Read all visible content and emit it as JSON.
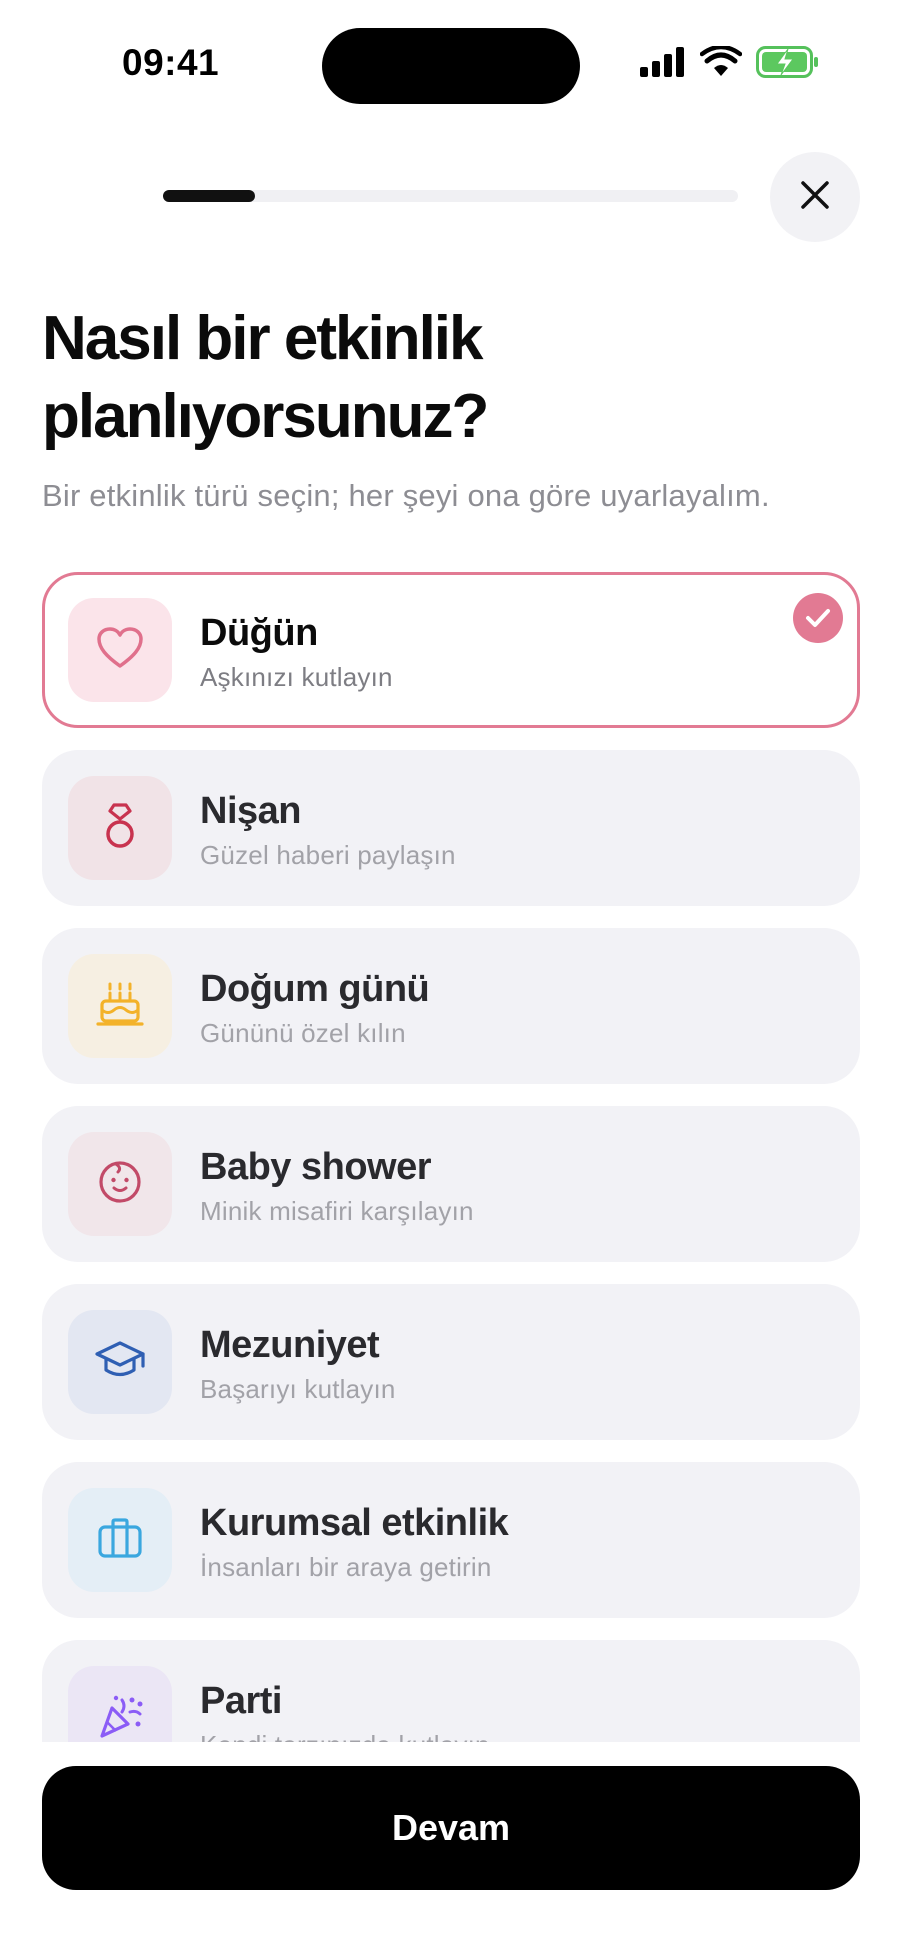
{
  "status_bar": {
    "time": "09:41",
    "icons": [
      "signal-icon",
      "wifi-icon",
      "battery-charging-icon"
    ]
  },
  "header": {
    "progress": 0.16,
    "close_icon": "close-icon"
  },
  "title": "Nasıl bir etkinlik planlıyorsunuz?",
  "subtitle": "Bir etkinlik türü seçin; her şeyi ona göre uyarlayalım.",
  "event_types": [
    {
      "id": "wedding",
      "title": "Düğün",
      "subtitle": "Aşkınızı kutlayın",
      "icon": "heart-icon",
      "icon_color": "#e0708c",
      "icon_bg": "#fbe4ea",
      "selected": true
    },
    {
      "id": "engagement",
      "title": "Nişan",
      "subtitle": "Güzel haberi paylaşın",
      "icon": "ring-icon",
      "icon_color": "#c8334f",
      "icon_bg": "#f1e3e7",
      "selected": false
    },
    {
      "id": "birthday",
      "title": "Doğum günü",
      "subtitle": "Gününü özel kılın",
      "icon": "cake-icon",
      "icon_color": "#f3b22a",
      "icon_bg": "#f6efe2",
      "selected": false
    },
    {
      "id": "baby-shower",
      "title": "Baby shower",
      "subtitle": "Minik misafiri karşılayın",
      "icon": "baby-icon",
      "icon_color": "#c24a68",
      "icon_bg": "#f1e6ea",
      "selected": false
    },
    {
      "id": "graduation",
      "title": "Mezuniyet",
      "subtitle": "Başarıyı kutlayın",
      "icon": "graduation-cap-icon",
      "icon_color": "#2f5fb3",
      "icon_bg": "#e3e7f2",
      "selected": false
    },
    {
      "id": "corporate",
      "title": "Kurumsal etkinlik",
      "subtitle": "İnsanları bir araya getirin",
      "icon": "briefcase-icon",
      "icon_color": "#3aa7df",
      "icon_bg": "#e4eef6",
      "selected": false
    },
    {
      "id": "party",
      "title": "Parti",
      "subtitle": "Kendi tarzınızda kutlayın",
      "icon": "party-popper-icon",
      "icon_color": "#8b5cf6",
      "icon_bg": "#ebe6f5",
      "selected": false
    }
  ],
  "continue_label": "Devam",
  "colors": {
    "accent": "#e27a93",
    "button": "#000000"
  }
}
